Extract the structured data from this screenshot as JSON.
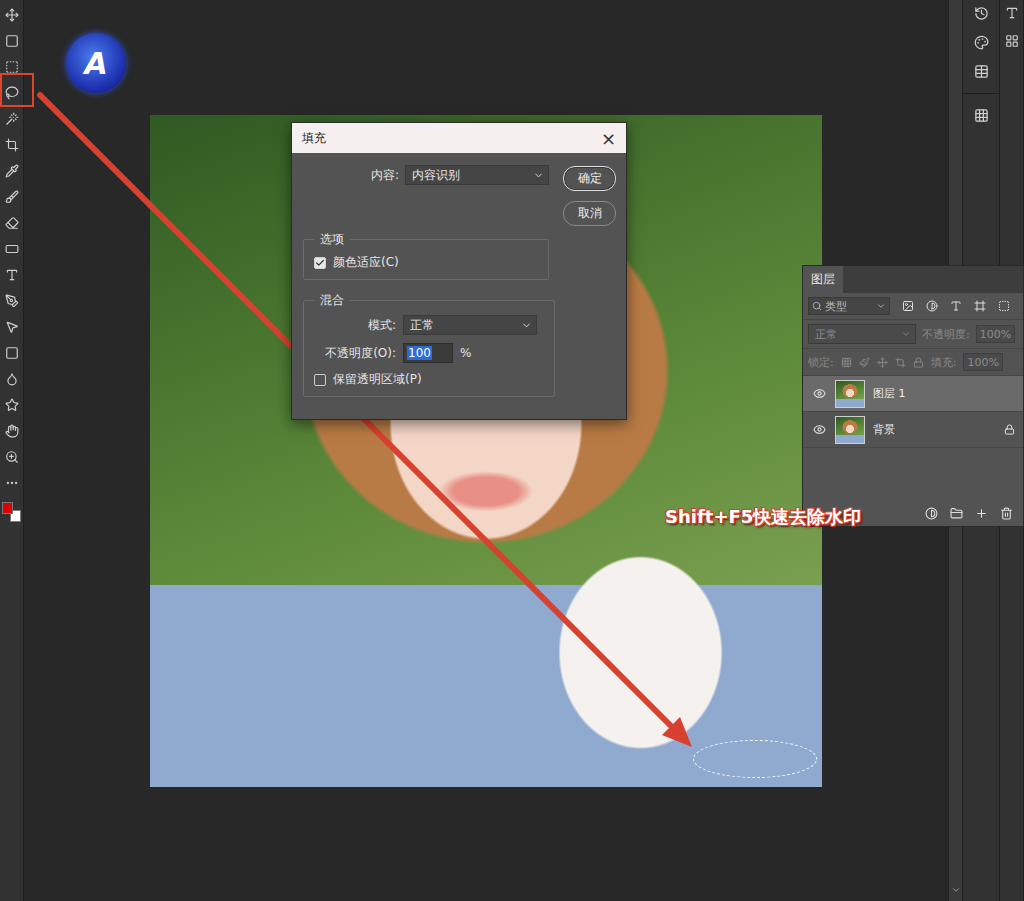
{
  "logo": {
    "letter": "A"
  },
  "dialog": {
    "title": "填充",
    "close": "×",
    "content_label": "内容:",
    "content_value": "内容识别",
    "buttons": [
      {
        "label": "确定",
        "default": true
      },
      {
        "label": "取消",
        "default": false
      }
    ],
    "options_group": "选项",
    "options": [
      {
        "label": "颜色适应(C)",
        "checked": true
      }
    ],
    "blend_group": "混合",
    "mode_label": "模式:",
    "mode_value": "正常",
    "opacity_label": "不透明度(O):",
    "opacity_value": "100",
    "opacity_unit": "%",
    "preserve": {
      "label": "保留透明区域(P)",
      "checked": false
    }
  },
  "layers_panel": {
    "tab": "图层",
    "filter_placeholder": "类型",
    "blend_mode": "正常",
    "opacity_label": "不透明度:",
    "opacity_value": "100%",
    "lock_label": "锁定:",
    "fill_label": "填充:",
    "fill_value": "100%",
    "disabled": true,
    "layers": [
      {
        "name": "图层 1",
        "selected": true,
        "visible": true,
        "locked": false
      },
      {
        "name": "背景",
        "selected": false,
        "visible": true,
        "locked": true
      }
    ]
  },
  "annotation": {
    "text": "Shift+F5快速去除水印"
  },
  "swatches": [
    {
      "name": "foreground",
      "color": "#e00000"
    },
    {
      "name": "background",
      "color": "#ffffff"
    }
  ]
}
